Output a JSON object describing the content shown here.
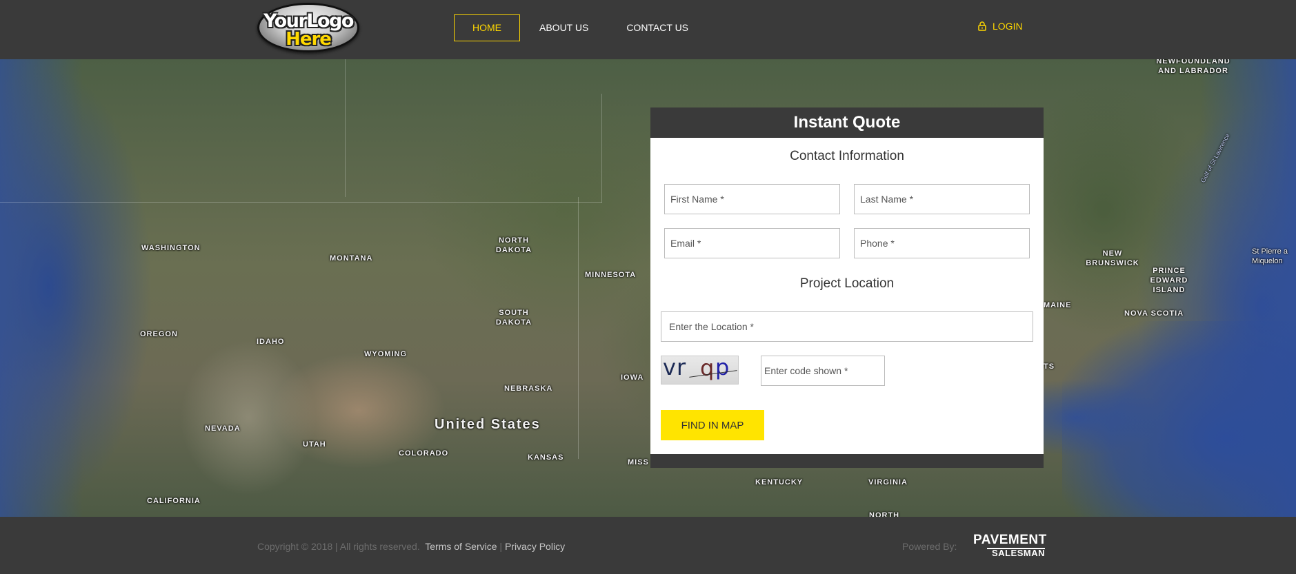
{
  "header": {
    "logo": {
      "line1": "YourLogo",
      "line2": "Here"
    },
    "nav": [
      {
        "label": "HOME",
        "active": true
      },
      {
        "label": "ABOUT US"
      },
      {
        "label": "CONTACT US"
      }
    ],
    "login_label": "LOGIN",
    "accent_color": "#ffd800"
  },
  "map": {
    "labels": {
      "newfoundland": "NEWFOUNDLAND\nAND LABRADOR",
      "washington": "WASHINGTON",
      "montana": "MONTANA",
      "north_dakota": "NORTH\nDAKOTA",
      "minnesota": "MINNESOTA",
      "south_dakota": "SOUTH\nDAKOTA",
      "oregon": "OREGON",
      "idaho": "IDAHO",
      "wyoming": "WYOMING",
      "nebraska": "NEBRASKA",
      "iowa": "IOWA",
      "nevada": "NEVADA",
      "utah": "UTAH",
      "colorado": "COLORADO",
      "kansas": "KANSAS",
      "miss": "MISS",
      "california": "CALIFORNIA",
      "united_states": "United States",
      "new_brunswick": "NEW\nBRUNSWICK",
      "prince_edward_island": "PRINCE\nEDWARD\nISLAND",
      "maine": "MAINE",
      "nova_scotia": "NOVA SCOTIA",
      "st_pierre": "St Pierre a\nMiquelon",
      "gulf": "Gulf of St Lawrence",
      "ts": "TS",
      "kentucky": "KENTUCKY",
      "virginia": "VIRGINIA",
      "north": "NORTH"
    }
  },
  "quote": {
    "title": "Instant Quote",
    "contact_heading": "Contact Information",
    "first_name_placeholder": "First Name *",
    "last_name_placeholder": "Last Name *",
    "email_placeholder": "Email *",
    "phone_placeholder": "Phone *",
    "location_heading": "Project Location",
    "location_placeholder": "Enter the Location *",
    "captcha_text": [
      "v",
      "r",
      "q",
      "p"
    ],
    "captcha_placeholder": "Enter code shown *",
    "submit_label": "FIND IN MAP",
    "button_color": "#ffe400"
  },
  "footer": {
    "copyright": "Copyright © 2018 | All rights reserved.",
    "terms_label": "Terms of Service",
    "separator": "|",
    "privacy_label": "Privacy Policy",
    "powered_by": "Powered By:",
    "brand_line1": "PAVEMENT",
    "brand_line2": "SALESMAN"
  }
}
